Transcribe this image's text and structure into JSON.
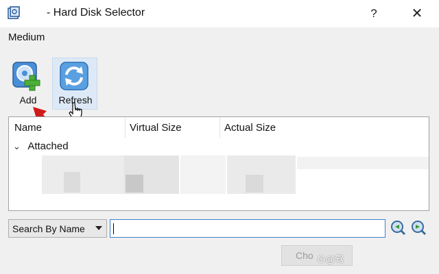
{
  "window": {
    "title": "- Hard Disk Selector",
    "help_label": "?",
    "close_label": "✕",
    "icon": "virtualbox-app-icon"
  },
  "menu": {
    "medium_label": "Medium"
  },
  "toolbar": {
    "add_label": "Add",
    "add_icon": "add-disk-icon",
    "refresh_label": "Refresh",
    "refresh_icon": "refresh-icon"
  },
  "list": {
    "columns": [
      "Name",
      "Virtual Size",
      "Actual Size"
    ],
    "group_label": "Attached",
    "group_chevron": "⌄"
  },
  "search": {
    "mode_label": "Search By Name",
    "query": "",
    "prev_icon": "search-previous-icon",
    "next_icon": "search-next-icon"
  },
  "footer": {
    "choose_label": "Cho",
    "watermark": "⊙@驾"
  },
  "colors": {
    "accent": "#3c7fd1",
    "annotation_arrow": "#d11a1a",
    "toolbar_highlight": "#dde9f6"
  }
}
